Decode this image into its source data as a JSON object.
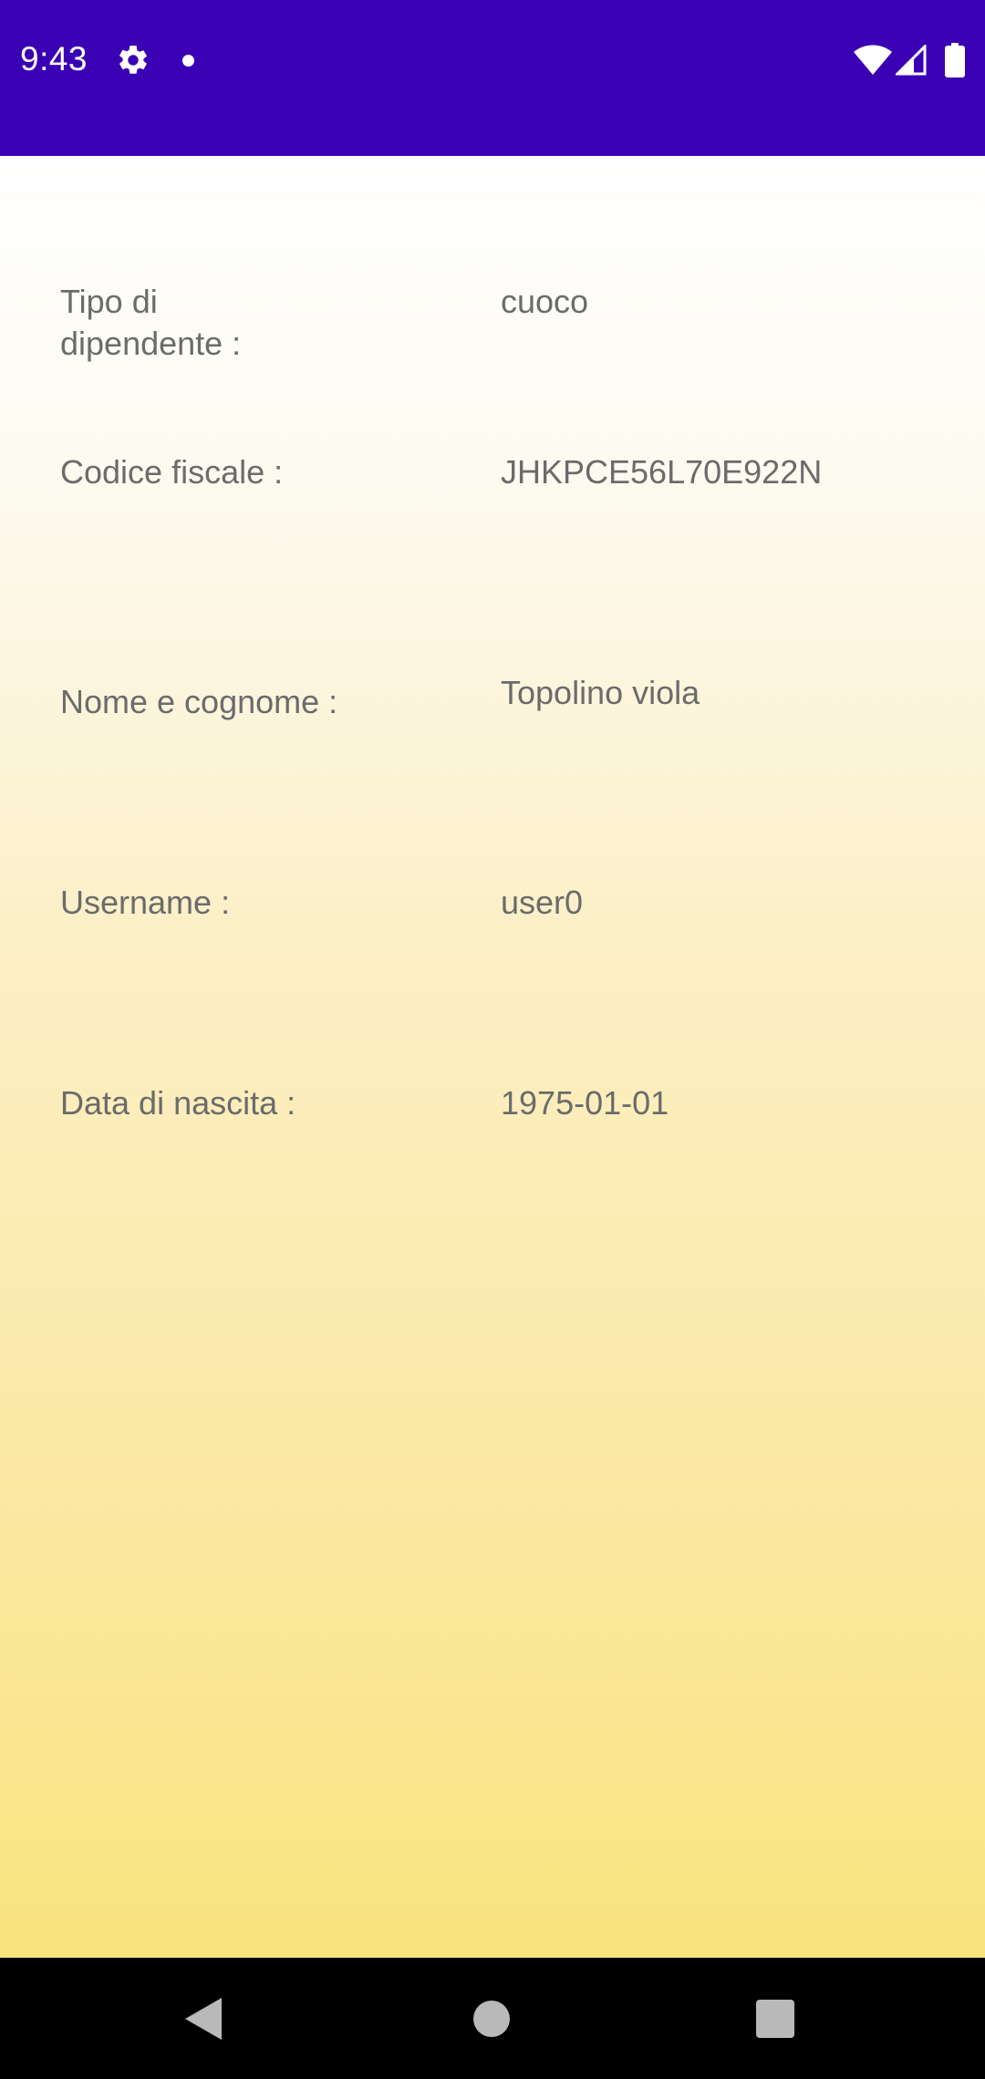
{
  "status_bar": {
    "time": "9:43",
    "background_color": "#3A00B4",
    "icons": [
      "gear-icon",
      "notification-dot-icon",
      "wifi-icon",
      "cell-signal-icon",
      "battery-icon"
    ]
  },
  "details": [
    {
      "label": "Tipo di\ndipendente :",
      "value": "cuoco"
    },
    {
      "label": "Codice fiscale :",
      "value": "JHKPCE56L70E922N"
    },
    {
      "label": "Nome e cognome :",
      "value": "Topolino viola"
    },
    {
      "label": "Username :",
      "value": "user0"
    },
    {
      "label": "Data di nascita :",
      "value": "1975-01-01"
    }
  ],
  "theme": {
    "gradient_top": "#ffffff",
    "gradient_bottom": "#f9e47e",
    "text_color": "#6b6b6b"
  },
  "nav_bar": {
    "icons": [
      "back-icon",
      "home-icon",
      "recents-icon"
    ]
  }
}
